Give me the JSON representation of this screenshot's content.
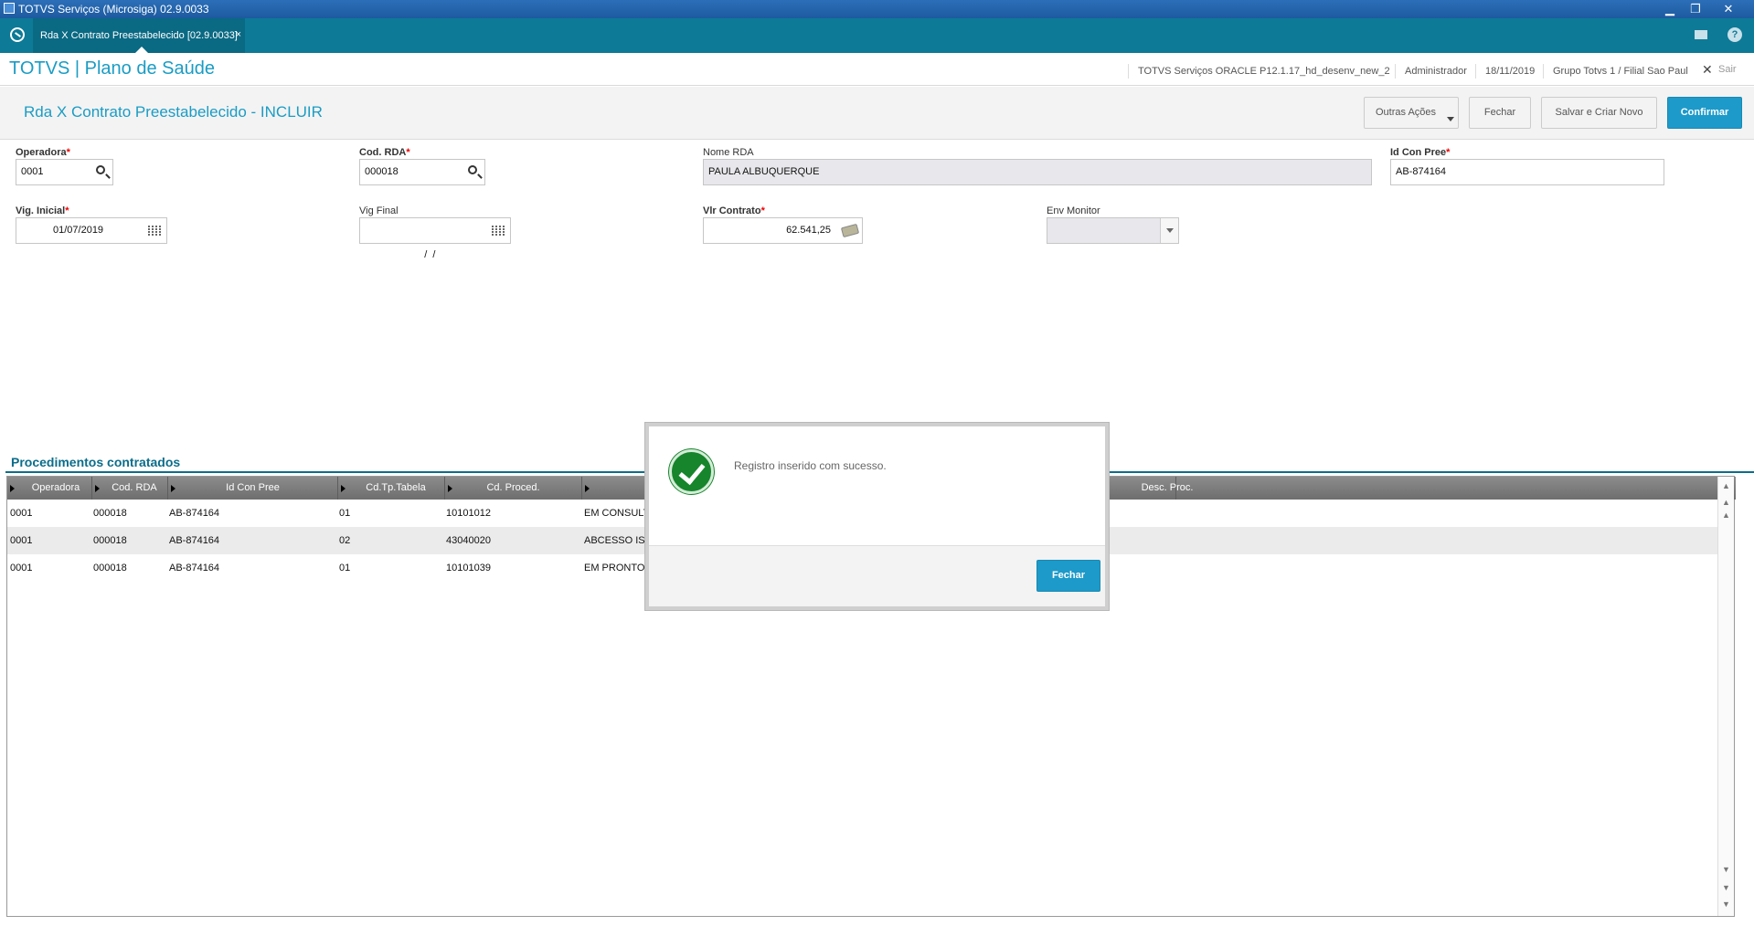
{
  "window": {
    "title": "TOTVS Serviços (Microsiga) 02.9.0033"
  },
  "tabbar": {
    "tab_label": "Rda X Contrato Preestabelecido [02.9.0033]",
    "tab_close": "×"
  },
  "header": {
    "brand": "TOTVS | Plano de Saúde",
    "environment": "TOTVS Serviços ORACLE P12.1.17_hd_desenv_new_2",
    "user": "Administrador",
    "date": "18/11/2019",
    "company": "Grupo Totvs 1 / Filial Sao Paul",
    "exit": "Sair"
  },
  "page": {
    "title": "Rda X Contrato Preestabelecido - INCLUIR",
    "buttons": {
      "other_actions": "Outras Ações",
      "close": "Fechar",
      "save_new": "Salvar e Criar Novo",
      "confirm": "Confirmar"
    }
  },
  "form": {
    "operadora": {
      "label": "Operadora",
      "value": "0001"
    },
    "cod_rda": {
      "label": "Cod. RDA",
      "value": "000018"
    },
    "nome_rda": {
      "label": "Nome RDA",
      "value": "PAULA ALBUQUERQUE"
    },
    "id_con_pree": {
      "label": "Id Con Pree",
      "value": "AB-874164"
    },
    "vig_inicial": {
      "label": "Vig. Inicial",
      "value": "01/07/2019"
    },
    "vig_final": {
      "label": "Vig Final",
      "value": "  /  /"
    },
    "vlr_contrato": {
      "label": "Vlr Contrato",
      "value": "62.541,25"
    },
    "env_monitor": {
      "label": "Env Monitor",
      "value": ""
    },
    "required_mark": "*"
  },
  "grid": {
    "title": "Procedimentos contratados",
    "columns": [
      "Operadora",
      "Cod. RDA",
      "Id Con Pree",
      "Cd.Tp.Tabela",
      "Cd. Proced.",
      "",
      "Desc. Proc."
    ],
    "rows": [
      [
        "0001",
        "000018",
        "AB-874164",
        "01",
        "10101012",
        "EM CONSULTO"
      ],
      [
        "0001",
        "000018",
        "AB-874164",
        "02",
        "43040020",
        "ABCESSO ISO"
      ],
      [
        "0001",
        "000018",
        "AB-874164",
        "01",
        "10101039",
        "EM PRONTO S"
      ]
    ]
  },
  "modal": {
    "message": "Registro inserido com sucesso.",
    "button": "Fechar"
  },
  "colors": {
    "accent": "#1d9ac9",
    "tabbar": "#0d7a97",
    "success": "#16852c"
  }
}
